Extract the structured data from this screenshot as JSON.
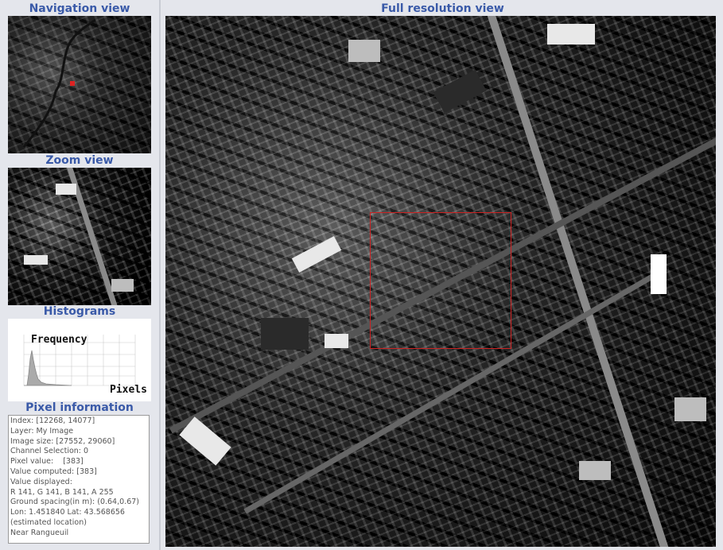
{
  "panels": {
    "navigation_title": "Navigation view",
    "zoom_title": "Zoom view",
    "histograms_title": "Histograms",
    "pixel_info_title": "Pixel information",
    "full_res_title": "Full resolution view"
  },
  "histogram": {
    "ylabel": "Frequency",
    "xlabel": "Pixels"
  },
  "pixel_info": [
    "Index: [12268, 14077]",
    "Layer: My Image",
    "Image size: [27552, 29060]",
    "Channel Selection: 0",
    "Pixel value:    [383]",
    "Value computed: [383]",
    "Value displayed:",
    "R 141, G 141, B 141, A 255",
    "Ground spacing(in m): (0.64,0.67)",
    "Lon: 1.451840 Lat: 43.568656",
    "(estimated location)",
    "Near Rangueuil"
  ],
  "colors": {
    "title": "#3a5aa8",
    "selection": "#cc2222",
    "background": "#e4e6ec"
  }
}
